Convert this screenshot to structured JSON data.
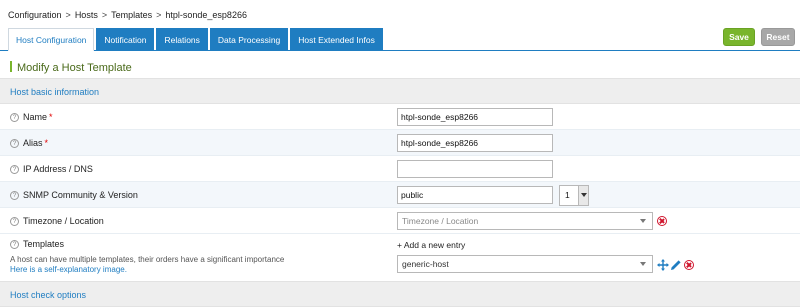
{
  "breadcrumb": {
    "items": [
      "Configuration",
      "Hosts",
      "Templates",
      "htpl-sonde_esp8266"
    ],
    "separator": ">"
  },
  "tabs": [
    {
      "label": "Host Configuration",
      "active": true
    },
    {
      "label": "Notification",
      "active": false
    },
    {
      "label": "Relations",
      "active": false
    },
    {
      "label": "Data Processing",
      "active": false
    },
    {
      "label": "Host Extended Infos",
      "active": false
    }
  ],
  "actions": {
    "save_label": "Save",
    "reset_label": "Reset"
  },
  "page_title": "Modify a Host Template",
  "sections": {
    "basic": "Host basic information",
    "check": "Host check options"
  },
  "fields": {
    "name": {
      "label": "Name",
      "required": "*",
      "value": "htpl-sonde_esp8266"
    },
    "alias": {
      "label": "Alias",
      "required": "*",
      "value": "htpl-sonde_esp8266"
    },
    "ip": {
      "label": "IP Address / DNS",
      "value": ""
    },
    "snmp": {
      "label": "SNMP Community & Version",
      "value": "public",
      "version": "1"
    },
    "timezone": {
      "label": "Timezone / Location",
      "placeholder": "Timezone / Location"
    },
    "templates": {
      "label": "Templates",
      "add_entry": "+ Add a new entry",
      "note": "A host can have multiple templates, their orders have a significant importance",
      "link": "Here is a self-explanatory image.",
      "selected": "generic-host"
    }
  },
  "help_glyph": "?",
  "colors": {
    "accent": "#1f7dc1",
    "save": "#79b52c",
    "reset": "#a8a8a8",
    "remove": "#d0142c",
    "title": "#4a6a1a"
  }
}
